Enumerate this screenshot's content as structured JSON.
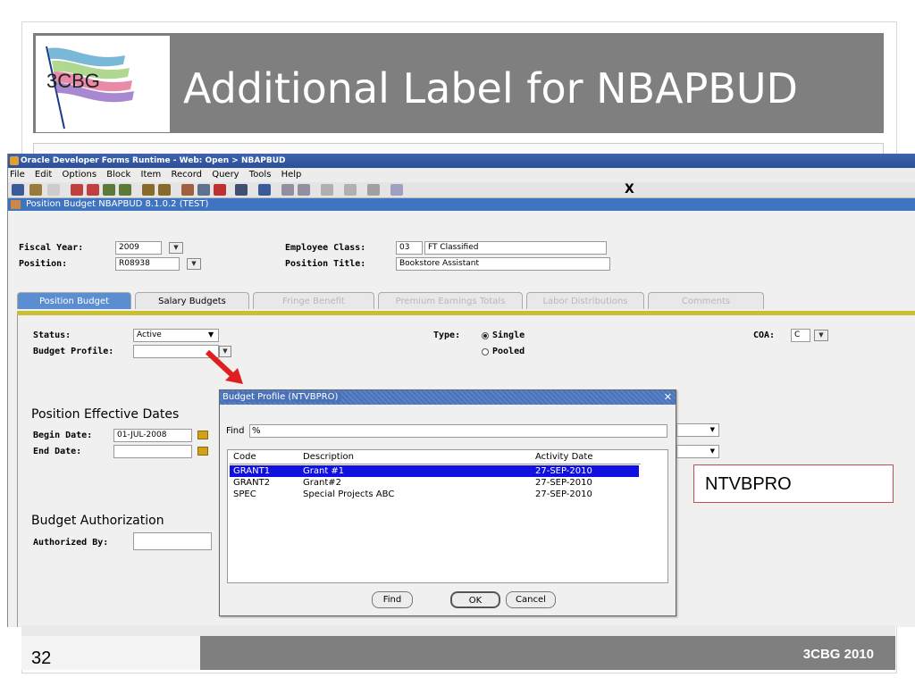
{
  "slide": {
    "title": "Additional Label for NBAPBUD",
    "logo_text": "3CBG",
    "page_number": "32",
    "footer_brand": "3CBG 2010",
    "callout": "NTVBPRO"
  },
  "window": {
    "title": "Oracle Developer Forms Runtime - Web: Open > NBAPBUD",
    "menu": [
      "File",
      "Edit",
      "Options",
      "Block",
      "Item",
      "Record",
      "Query",
      "Tools",
      "Help"
    ],
    "toolbar_close": "X",
    "form_title": "Position Budget  NBAPBUD  8.1.0.2  (TEST)"
  },
  "key_block": {
    "fiscal_year_label": "Fiscal Year:",
    "fiscal_year_value": "2009",
    "position_label": "Position:",
    "position_value": "R08938",
    "employee_class_label": "Employee Class:",
    "employee_class_code": "03",
    "employee_class_desc": "FT Classified",
    "position_title_label": "Position Title:",
    "position_title_value": "Bookstore Assistant"
  },
  "tabs": [
    {
      "label": "Position Budget",
      "state": "active"
    },
    {
      "label": "Salary Budgets",
      "state": "normal"
    },
    {
      "label": "Fringe Benefit",
      "state": "disabled"
    },
    {
      "label": "Premium Earnings Totals",
      "state": "disabled"
    },
    {
      "label": "Labor Distributions",
      "state": "disabled"
    },
    {
      "label": "Comments",
      "state": "disabled"
    }
  ],
  "main": {
    "status_label": "Status:",
    "status_value": "Active",
    "budget_profile_label": "Budget Profile:",
    "budget_profile_value": "",
    "type_label": "Type:",
    "type_single": "Single",
    "type_pooled": "Pooled",
    "coa_label": "COA:",
    "coa_value": "C",
    "effective_dates_heading": "Position Effective Dates",
    "begin_date_label": "Begin Date:",
    "begin_date_value": "01-JUL-2008",
    "end_date_label": "End Date:",
    "end_date_value": "",
    "budget_auth_heading": "Budget Authorization",
    "authorized_by_label": "Authorized By:",
    "authorized_by_value": ""
  },
  "dialog": {
    "title": "Budget Profile (NTVBPRO)",
    "close": "✕",
    "find_label": "Find",
    "find_value": "%",
    "columns": [
      "Code",
      "Description",
      "Activity Date"
    ],
    "rows": [
      {
        "code": "GRANT1",
        "description": "Grant #1",
        "date": "27-SEP-2010",
        "selected": true
      },
      {
        "code": "GRANT2",
        "description": "Grant#2",
        "date": "27-SEP-2010",
        "selected": false
      },
      {
        "code": "SPEC",
        "description": "Special Projects ABC",
        "date": "27-SEP-2010",
        "selected": false
      }
    ],
    "find_button": "Find",
    "ok_button": "OK",
    "cancel_button": "Cancel"
  },
  "colors": {
    "title_band": "#7f7f7f",
    "tab_active": "#5a8ed0",
    "selection": "#1010e0",
    "arrow": "#e02020",
    "callout_border": "#c0504d"
  }
}
